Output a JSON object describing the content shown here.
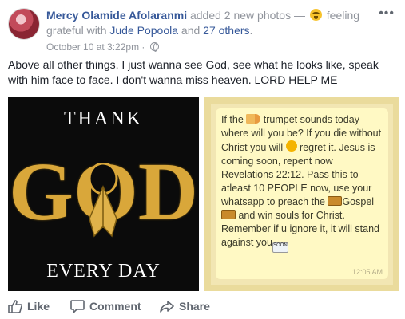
{
  "header": {
    "author": "Mercy Olamide Afolaranmi",
    "action_text": " added 2 new photos — ",
    "feeling_text": " feeling grateful with ",
    "tagged_person": "Jude Popoola",
    "and_text": " and ",
    "others_text": "27 others",
    "period": ".",
    "timestamp": "October 10 at 3:22pm",
    "separator": " · "
  },
  "post": {
    "caption": "Above all other things, I just wanna see God, see what he looks like, speak with him face to face. I don't wanna miss heaven. LORD HELP ME"
  },
  "photos": {
    "left": {
      "top_text": "THANK",
      "main_text": "GOD",
      "bottom_text": "EVERY DAY"
    },
    "right": {
      "t1": "If the ",
      "t2": " trumpet sounds today where will you be? If you die without Christ you will ",
      "t3": " regret it. Jesus is coming soon, repent now Revelations 22:12. Pass this to atleast 10 PEOPLE now, use your whatsapp to preach the ",
      "t4": "Gospel",
      "t5": " and win souls for Christ. Remember if u ignore it, it will stand against you",
      "soon": "SOON",
      "time": "12:05 AM"
    }
  },
  "actions": {
    "like": "Like",
    "comment": "Comment",
    "share": "Share"
  },
  "icons": [
    "more-icon",
    "globe-icon",
    "emoji-icon",
    "like-icon",
    "comment-icon",
    "share-icon"
  ]
}
